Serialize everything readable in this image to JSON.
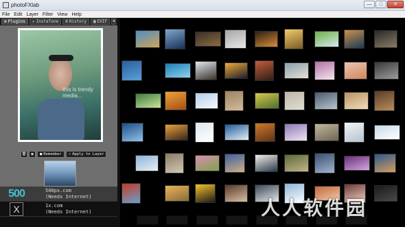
{
  "window": {
    "title": "photoFXlab",
    "buttons": {
      "minimize": "—",
      "maximize": "□",
      "close": "✕"
    }
  },
  "menu": [
    "File",
    "Edit",
    "Layer",
    "Filter",
    "View",
    "Help"
  ],
  "tabs": [
    {
      "label": "Plugins",
      "icon": "gear-icon",
      "active": true
    },
    {
      "label": "InstaTone",
      "icon": "star-icon"
    },
    {
      "label": "History",
      "icon": "list-icon"
    },
    {
      "label": "EXIF",
      "icon": "grid-icon"
    }
  ],
  "tab_arrow": "◂",
  "preview": {
    "overlay_text": "this is trendy media..."
  },
  "controls": {
    "remember": "Remember",
    "apply": "Apply to Layer",
    "delete_icon": "trash-icon",
    "save_icon": "disk-icon"
  },
  "sources": [
    {
      "logo": "500",
      "name": "500px.com",
      "status": "(Needs Internet)"
    },
    {
      "logo": "X",
      "name": "1x.com",
      "status": "(Needs Internet)"
    }
  ],
  "gallery": {
    "rows": [
      [
        [
          "#4f8fc2",
          "#d1a35a"
        ],
        [
          "#7fa7cf",
          "#1a2f52"
        ],
        [
          "#3b3026",
          "#8c6a43"
        ],
        [
          "#a6a6a6",
          "#e8e8e8"
        ],
        [
          "#2b2016",
          "#d98a37"
        ],
        [
          "#f2cc6a",
          "#7a5a25"
        ],
        [
          "#6fb047",
          "#d5e8f0"
        ],
        [
          "#cc8f48",
          "#1a3a58"
        ],
        [
          "#2a2a2a",
          "#8a7c63"
        ]
      ],
      [
        [
          "#2a5f9c",
          "#5aa0d8"
        ],
        [
          "#1e7fb4",
          "#8dd3ef"
        ],
        [
          "#dfe7ef",
          "#3a3129"
        ],
        [
          "#f2a93b",
          "#1c1e2b"
        ],
        [
          "#c25d3a",
          "#2f1e1a"
        ],
        [
          "#8aa1a9",
          "#e6dfd6"
        ],
        [
          "#b36fa6",
          "#f3e7ef"
        ],
        [
          "#e8c4b6",
          "#d2865a"
        ],
        [
          "#3a3a3a",
          "#9c9c9c"
        ]
      ],
      [
        [
          "#3e7d40",
          "#cbe39b"
        ],
        [
          "#f0a03b",
          "#a25015"
        ],
        [
          "#b5d0ea",
          "#f5f8fb"
        ],
        [
          "#9c8361",
          "#d1bc9b"
        ],
        [
          "#d6c84e",
          "#4e6d2e"
        ],
        [
          "#bcb7a8",
          "#e2ddd2"
        ],
        [
          "#4c5b6e",
          "#b9c4cf"
        ],
        [
          "#b99463",
          "#f0dcbb"
        ],
        [
          "#5b3d2a",
          "#b98c5b"
        ]
      ],
      [
        [
          "#1f4f86",
          "#8fc1e6"
        ],
        [
          "#e6a13e",
          "#37261c"
        ],
        [
          "#dce8f1",
          "#ffffff"
        ],
        [
          "#1f5f9c",
          "#e6eef5"
        ],
        [
          "#d17a2b",
          "#5b3319"
        ],
        [
          "#8b7ab8",
          "#f1e5ef"
        ],
        [
          "#c1b7a0",
          "#6e6552"
        ],
        [
          "#f1f4f7",
          "#b5c3cf"
        ],
        [
          "#c7dbe8",
          "#ffffff"
        ]
      ],
      [
        [
          "#8fb3d6",
          "#e6f0f7"
        ],
        [
          "#8a7b66",
          "#d3c8b5"
        ],
        [
          "#d68fb0",
          "#7fa24a"
        ],
        [
          "#3d5f9c",
          "#d0b08a"
        ],
        [
          "#f1eee8",
          "#2a3a4a"
        ],
        [
          "#5b6a3a",
          "#c4b48a"
        ],
        [
          "#3b4f6e",
          "#9fb5cf"
        ],
        [
          "#6b2e78",
          "#d2a6e3"
        ],
        [
          "#2c5a8c",
          "#d49b62"
        ]
      ],
      [
        [
          "#c23b2a",
          "#6aa0c9"
        ],
        [
          "#e7b45a",
          "#8a6a3a"
        ],
        [
          "#f5c12a",
          "#1a1a1a"
        ],
        [
          "#5a3a2a",
          "#d8c0a4"
        ],
        [
          "#3a4a5a",
          "#e4e4e4"
        ],
        [
          "#8fb4d6",
          "#ffffff"
        ],
        [
          "#c26a3a",
          "#eec9a8"
        ],
        [
          "#6a3a3a",
          "#f0d0c0"
        ],
        [
          "#1a1a1a",
          "#4a4a4a"
        ]
      ]
    ]
  },
  "watermark": "人人软件园"
}
